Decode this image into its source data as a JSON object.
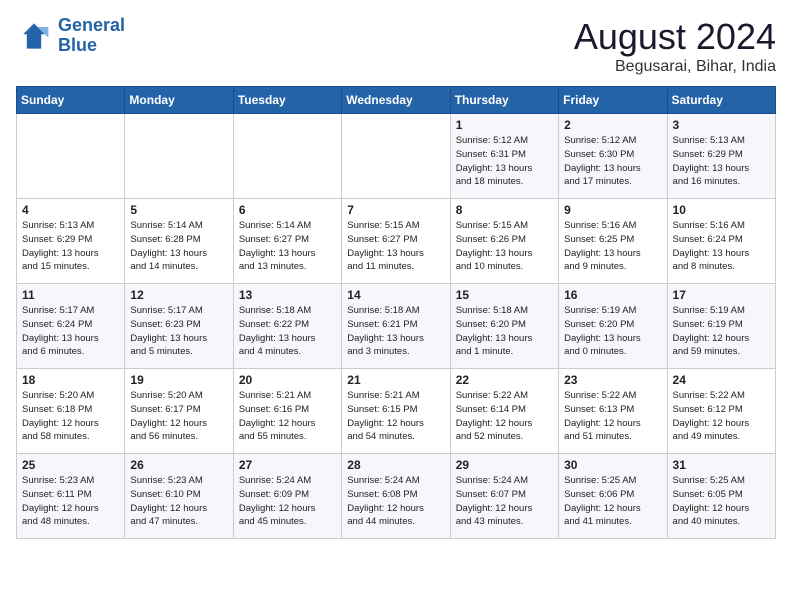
{
  "header": {
    "logo_line1": "General",
    "logo_line2": "Blue",
    "month": "August 2024",
    "location": "Begusarai, Bihar, India"
  },
  "weekdays": [
    "Sunday",
    "Monday",
    "Tuesday",
    "Wednesday",
    "Thursday",
    "Friday",
    "Saturday"
  ],
  "weeks": [
    [
      {
        "day": "",
        "info": ""
      },
      {
        "day": "",
        "info": ""
      },
      {
        "day": "",
        "info": ""
      },
      {
        "day": "",
        "info": ""
      },
      {
        "day": "1",
        "info": "Sunrise: 5:12 AM\nSunset: 6:31 PM\nDaylight: 13 hours\nand 18 minutes."
      },
      {
        "day": "2",
        "info": "Sunrise: 5:12 AM\nSunset: 6:30 PM\nDaylight: 13 hours\nand 17 minutes."
      },
      {
        "day": "3",
        "info": "Sunrise: 5:13 AM\nSunset: 6:29 PM\nDaylight: 13 hours\nand 16 minutes."
      }
    ],
    [
      {
        "day": "4",
        "info": "Sunrise: 5:13 AM\nSunset: 6:29 PM\nDaylight: 13 hours\nand 15 minutes."
      },
      {
        "day": "5",
        "info": "Sunrise: 5:14 AM\nSunset: 6:28 PM\nDaylight: 13 hours\nand 14 minutes."
      },
      {
        "day": "6",
        "info": "Sunrise: 5:14 AM\nSunset: 6:27 PM\nDaylight: 13 hours\nand 13 minutes."
      },
      {
        "day": "7",
        "info": "Sunrise: 5:15 AM\nSunset: 6:27 PM\nDaylight: 13 hours\nand 11 minutes."
      },
      {
        "day": "8",
        "info": "Sunrise: 5:15 AM\nSunset: 6:26 PM\nDaylight: 13 hours\nand 10 minutes."
      },
      {
        "day": "9",
        "info": "Sunrise: 5:16 AM\nSunset: 6:25 PM\nDaylight: 13 hours\nand 9 minutes."
      },
      {
        "day": "10",
        "info": "Sunrise: 5:16 AM\nSunset: 6:24 PM\nDaylight: 13 hours\nand 8 minutes."
      }
    ],
    [
      {
        "day": "11",
        "info": "Sunrise: 5:17 AM\nSunset: 6:24 PM\nDaylight: 13 hours\nand 6 minutes."
      },
      {
        "day": "12",
        "info": "Sunrise: 5:17 AM\nSunset: 6:23 PM\nDaylight: 13 hours\nand 5 minutes."
      },
      {
        "day": "13",
        "info": "Sunrise: 5:18 AM\nSunset: 6:22 PM\nDaylight: 13 hours\nand 4 minutes."
      },
      {
        "day": "14",
        "info": "Sunrise: 5:18 AM\nSunset: 6:21 PM\nDaylight: 13 hours\nand 3 minutes."
      },
      {
        "day": "15",
        "info": "Sunrise: 5:18 AM\nSunset: 6:20 PM\nDaylight: 13 hours\nand 1 minute."
      },
      {
        "day": "16",
        "info": "Sunrise: 5:19 AM\nSunset: 6:20 PM\nDaylight: 13 hours\nand 0 minutes."
      },
      {
        "day": "17",
        "info": "Sunrise: 5:19 AM\nSunset: 6:19 PM\nDaylight: 12 hours\nand 59 minutes."
      }
    ],
    [
      {
        "day": "18",
        "info": "Sunrise: 5:20 AM\nSunset: 6:18 PM\nDaylight: 12 hours\nand 58 minutes."
      },
      {
        "day": "19",
        "info": "Sunrise: 5:20 AM\nSunset: 6:17 PM\nDaylight: 12 hours\nand 56 minutes."
      },
      {
        "day": "20",
        "info": "Sunrise: 5:21 AM\nSunset: 6:16 PM\nDaylight: 12 hours\nand 55 minutes."
      },
      {
        "day": "21",
        "info": "Sunrise: 5:21 AM\nSunset: 6:15 PM\nDaylight: 12 hours\nand 54 minutes."
      },
      {
        "day": "22",
        "info": "Sunrise: 5:22 AM\nSunset: 6:14 PM\nDaylight: 12 hours\nand 52 minutes."
      },
      {
        "day": "23",
        "info": "Sunrise: 5:22 AM\nSunset: 6:13 PM\nDaylight: 12 hours\nand 51 minutes."
      },
      {
        "day": "24",
        "info": "Sunrise: 5:22 AM\nSunset: 6:12 PM\nDaylight: 12 hours\nand 49 minutes."
      }
    ],
    [
      {
        "day": "25",
        "info": "Sunrise: 5:23 AM\nSunset: 6:11 PM\nDaylight: 12 hours\nand 48 minutes."
      },
      {
        "day": "26",
        "info": "Sunrise: 5:23 AM\nSunset: 6:10 PM\nDaylight: 12 hours\nand 47 minutes."
      },
      {
        "day": "27",
        "info": "Sunrise: 5:24 AM\nSunset: 6:09 PM\nDaylight: 12 hours\nand 45 minutes."
      },
      {
        "day": "28",
        "info": "Sunrise: 5:24 AM\nSunset: 6:08 PM\nDaylight: 12 hours\nand 44 minutes."
      },
      {
        "day": "29",
        "info": "Sunrise: 5:24 AM\nSunset: 6:07 PM\nDaylight: 12 hours\nand 43 minutes."
      },
      {
        "day": "30",
        "info": "Sunrise: 5:25 AM\nSunset: 6:06 PM\nDaylight: 12 hours\nand 41 minutes."
      },
      {
        "day": "31",
        "info": "Sunrise: 5:25 AM\nSunset: 6:05 PM\nDaylight: 12 hours\nand 40 minutes."
      }
    ]
  ]
}
